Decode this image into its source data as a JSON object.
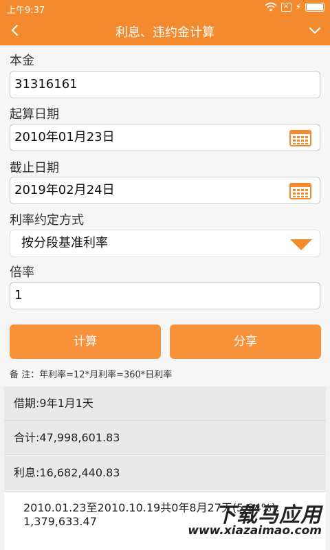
{
  "status": {
    "time": "上午9:37"
  },
  "titlebar": {
    "title": "利息、违约金计算"
  },
  "form": {
    "principal_label": "本金",
    "principal_value": "31316161",
    "start_label": "起算日期",
    "start_value": "2010年01月23日",
    "end_label": "截止日期",
    "end_value": "2019年02月24日",
    "rate_method_label": "利率约定方式",
    "rate_method_value": "按分段基准利率",
    "multiple_label": "倍率",
    "multiple_value": "1",
    "calc_button": "计算",
    "share_button": "分享",
    "note": "备 注：年利率=12*月利率=360*日利率"
  },
  "results": {
    "period": "借期:9年1月1天",
    "total": "合计:47,998,601.83",
    "interest": "利息:16,682,440.83",
    "detail_line1": "2010.01.23至2010.10.19共0年8月27天(5.94%):",
    "detail_line2": "1,379,633.47"
  },
  "watermark": {
    "title": "下载马应用",
    "url": "www.xiazaimao.com"
  },
  "colors": {
    "accent": "#f38a2e",
    "button": "#f7923a"
  },
  "icons": [
    "back-arrow-icon",
    "chevron-down-icon",
    "calendar-icon",
    "dropdown-arrow-icon",
    "wifi-icon",
    "battery-icon"
  ]
}
